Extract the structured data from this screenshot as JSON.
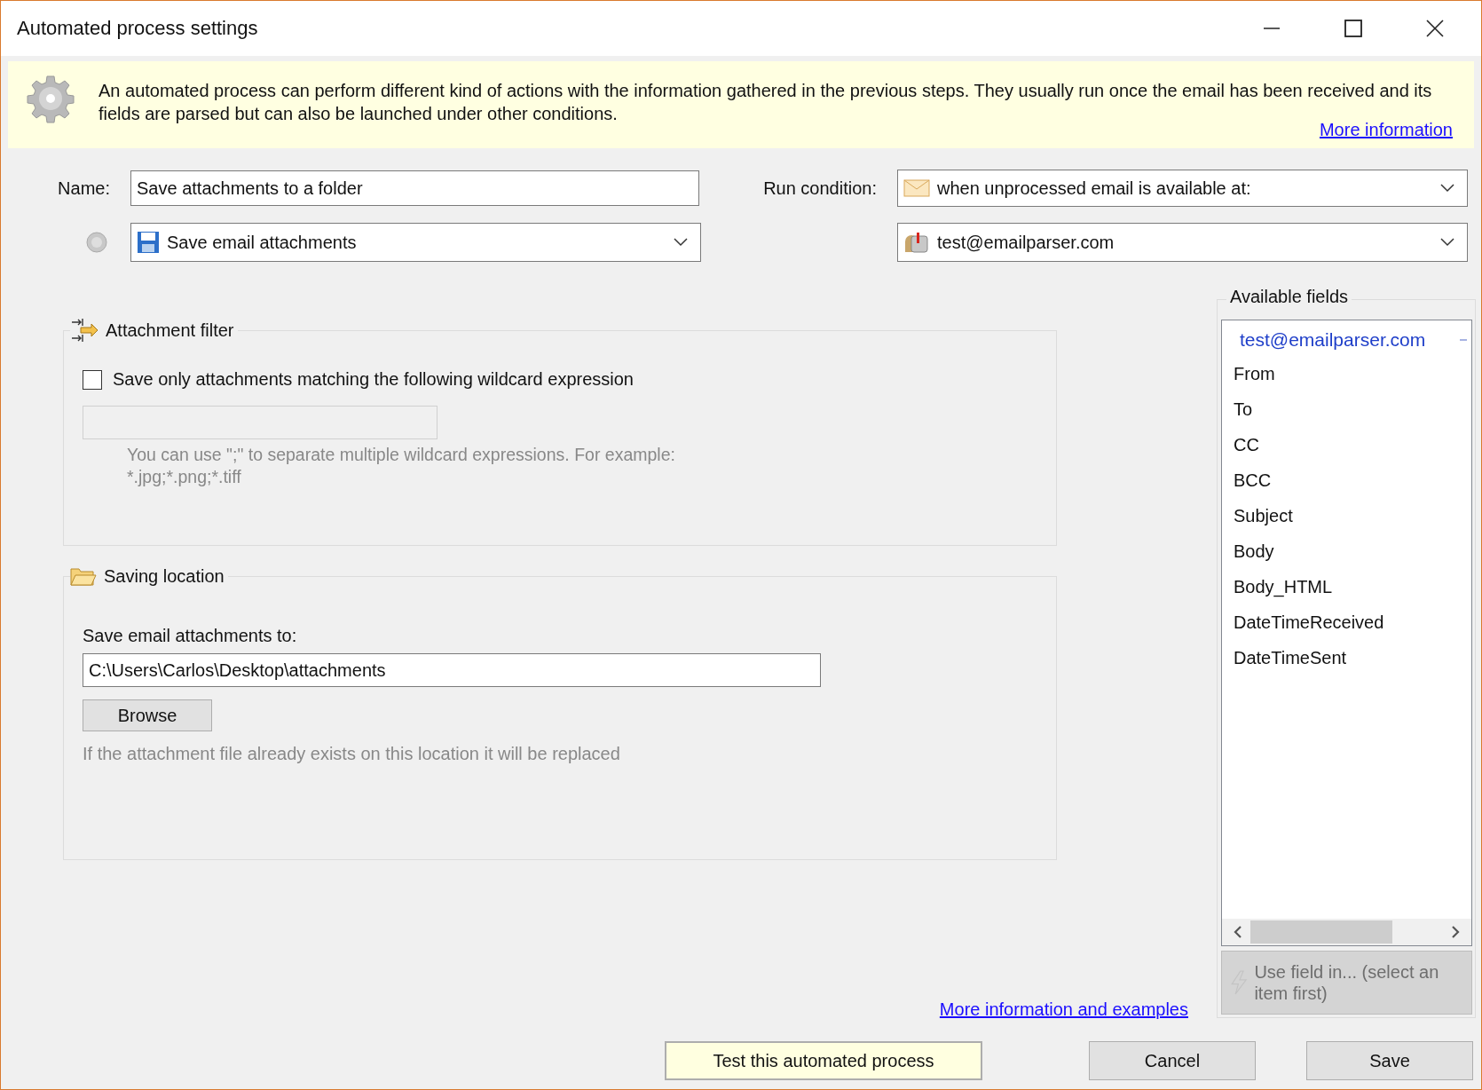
{
  "window": {
    "title": "Automated process settings"
  },
  "banner": {
    "text": "An automated process can perform different kind of actions with the information gathered in the previous steps. They usually run once the email has been received and its fields are parsed but can also be launched under other conditions.",
    "link": "More information"
  },
  "name": {
    "label": "Name:",
    "value": "Save attachments to a folder"
  },
  "action": {
    "value": "Save email attachments"
  },
  "run_condition": {
    "label": "Run condition:",
    "value": "when unprocessed email is available at:"
  },
  "mailbox": {
    "value": "test@emailparser.com"
  },
  "attachment_filter": {
    "title": "Attachment filter",
    "checkbox": {
      "label": "Save only attachments matching the following wildcard expression",
      "checked": false
    },
    "pattern": {
      "disabled": true
    },
    "hint": "You can use \";\" to separate multiple wildcard expressions. For example:\n*.jpg;*.png;*.tiff"
  },
  "saving_location": {
    "title": "Saving location",
    "label": "Save email attachments to:",
    "path": "C:\\Users\\Carlos\\Desktop\\attachments",
    "browse": "Browse",
    "note": "If the attachment file already exists on this location it will be replaced"
  },
  "available_fields": {
    "title": "Available fields",
    "group": {
      "label": "test@emailparser.com",
      "expanded": true,
      "children": [
        {
          "label": "From"
        },
        {
          "label": "To"
        },
        {
          "label": "CC"
        },
        {
          "label": "BCC"
        },
        {
          "label": "Subject"
        },
        {
          "label": "Body"
        },
        {
          "label": "Body_HTML"
        },
        {
          "label": "DateTimeReceived"
        },
        {
          "label": "DateTimeSent"
        }
      ]
    },
    "use_button": {
      "label": "Use field in... (select an item first)",
      "disabled": true
    }
  },
  "more_info_link": "More information and examples",
  "buttons": [
    {
      "label": "Test this automated process",
      "kind": "test"
    },
    {
      "label": "Cancel",
      "kind": "normal"
    },
    {
      "label": "Save",
      "kind": "normal"
    }
  ]
}
